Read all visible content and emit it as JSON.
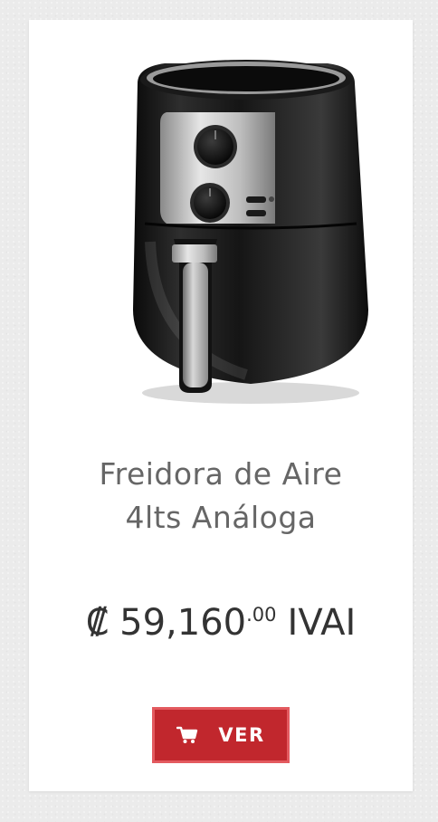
{
  "product": {
    "image_icon": "air-fryer-product-image",
    "title_line1": "Freidora de Aire",
    "title_line2": "4lts Análoga",
    "currency_symbol": "₡",
    "price_whole": "59,160",
    "price_cents": ".00",
    "price_suffix": "IVAI"
  },
  "button": {
    "icon": "shopping-cart-icon",
    "label": "VER",
    "color": "#c1272d"
  }
}
